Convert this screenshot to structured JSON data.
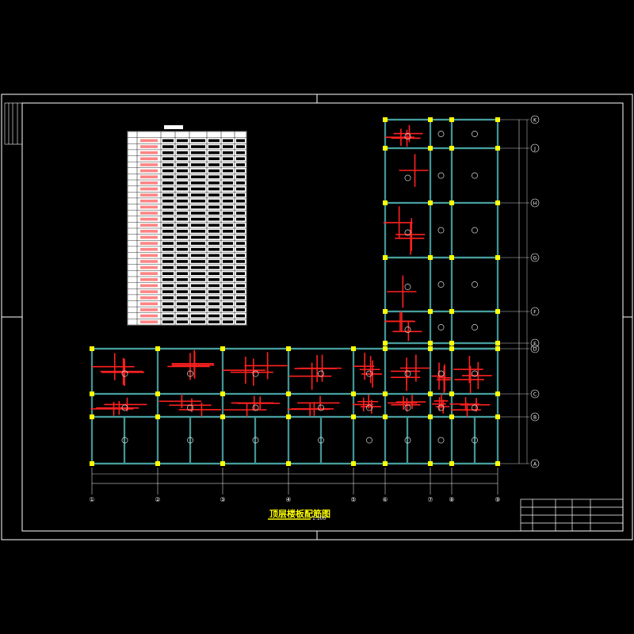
{
  "drawing": {
    "title": "顶层楼板配筋图",
    "scale": "1:100"
  },
  "colors": {
    "background": "#000000",
    "frame": "#ffffff",
    "beam": "#5fd3d3",
    "rebar": "#ff2020",
    "column": "#ffff00",
    "title": "#ffff00",
    "table_text": "#ffffff"
  },
  "grid_axes": {
    "bottom_labels": [
      "①",
      "②",
      "③",
      "④",
      "⑤",
      "⑥",
      "⑦",
      "⑧",
      "⑨"
    ],
    "right_labels": [
      "K",
      "J",
      "H",
      "G",
      "F",
      "E",
      "D",
      "C",
      "B",
      "A"
    ]
  },
  "title_block": {
    "rows": [
      [
        "",
        "",
        "",
        ""
      ],
      [
        "",
        "",
        "",
        ""
      ],
      [
        "",
        "",
        "",
        ""
      ],
      [
        "",
        "",
        "",
        ""
      ]
    ]
  },
  "rebar_table": {
    "title": "",
    "row_count": 31,
    "column_count": 7
  }
}
